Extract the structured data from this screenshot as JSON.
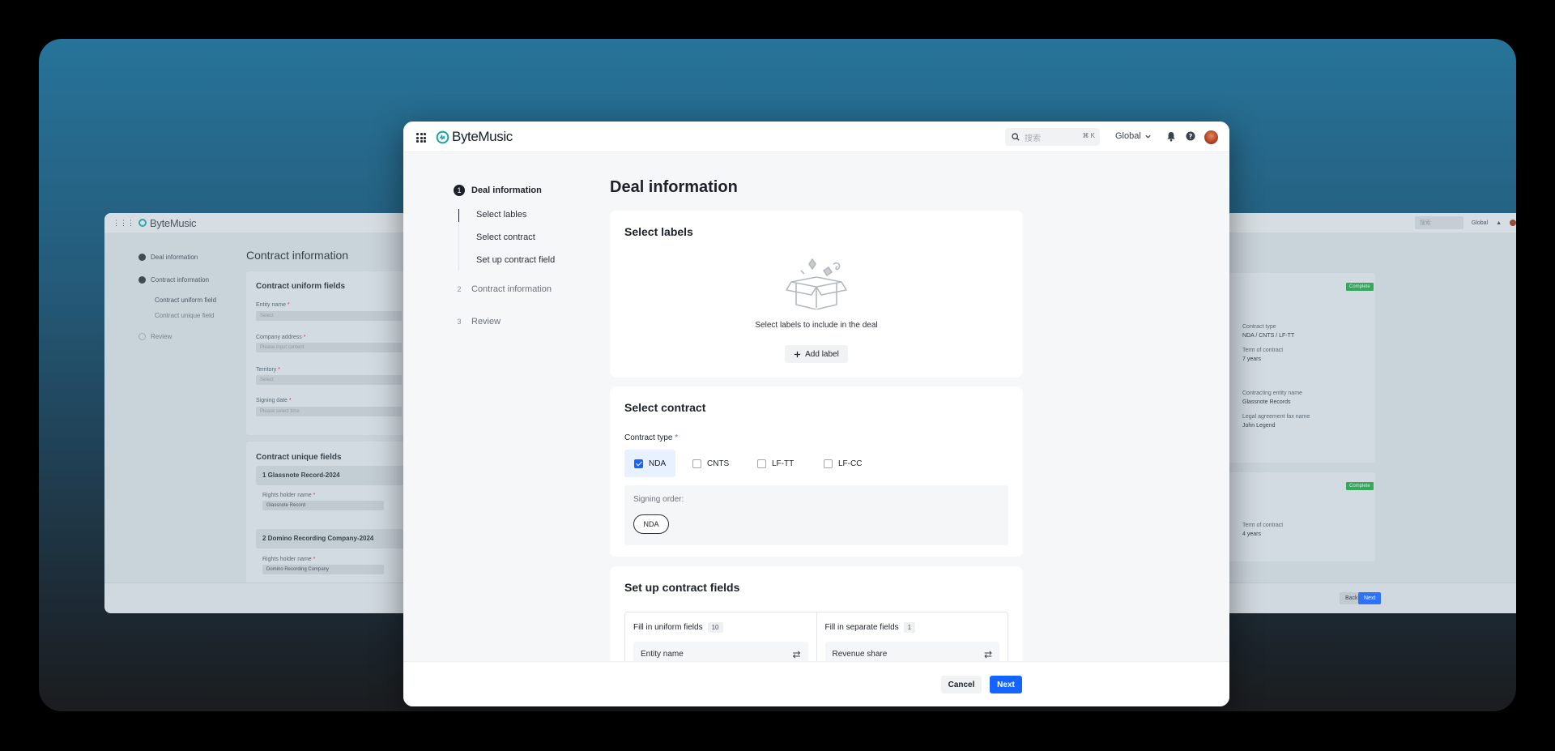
{
  "app": {
    "name": "ByteMusic"
  },
  "search": {
    "placeholder": "搜索",
    "shortcut": "⌘ K"
  },
  "header": {
    "region": "Global"
  },
  "stepper": {
    "steps": [
      {
        "num": "1",
        "label": "Deal information"
      },
      {
        "num": "2",
        "label": "Contract information"
      },
      {
        "num": "3",
        "label": "Review"
      }
    ],
    "substeps": [
      "Select lables",
      "Select contract",
      "Set up contract field"
    ]
  },
  "page": {
    "title": "Deal information"
  },
  "labels_card": {
    "title": "Select labels",
    "empty_text": "Select labels to include in the deal",
    "add_button": "Add label"
  },
  "contract_card": {
    "title": "Select contract",
    "field_label": "Contract type",
    "required_mark": "*",
    "options": [
      {
        "label": "NDA",
        "checked": true
      },
      {
        "label": "CNTS",
        "checked": false
      },
      {
        "label": "LF-TT",
        "checked": false
      },
      {
        "label": "LF-CC",
        "checked": false
      }
    ],
    "signing_order_label": "Signing order:",
    "signing_order_items": [
      "NDA"
    ]
  },
  "fields_card": {
    "title": "Set up contract fields",
    "uniform": {
      "label": "Fill in uniform fields",
      "count": "10",
      "first_field": "Entity name"
    },
    "separate": {
      "label": "Fill in separate fields",
      "count": "1",
      "first_field": "Revenue share"
    }
  },
  "footer": {
    "cancel": "Cancel",
    "next": "Next"
  },
  "background_left": {
    "app_name": "ByteMusic",
    "steps": [
      "Deal information",
      "Contract information",
      "Contract uniform field",
      "Contract unique field",
      "Review"
    ],
    "title": "Contract information",
    "uniform_title": "Contract uniform fields",
    "fields": [
      {
        "label": "Entity name",
        "placeholder": "Select"
      },
      {
        "label": "Company address",
        "placeholder": "Please input content"
      },
      {
        "label": "Territory",
        "placeholder": "Select"
      },
      {
        "label": "Signing date",
        "placeholder": "Please select time"
      }
    ],
    "unique_title": "Contract unique fields",
    "rows": [
      {
        "title": "1  Glassnote Record-2024",
        "sub_label": "Rights holder name",
        "sub_value": "Glassnote Record"
      },
      {
        "title": "2  Domino Recording Company-2024",
        "sub_label": "Rights holder name",
        "sub_value": "Domino Recording Company"
      }
    ]
  },
  "background_right": {
    "search_placeholder": "搜索",
    "region": "Global",
    "tag": "Complete",
    "items": [
      {
        "label": "Contract type",
        "value": "NDA / CNTS / LF-TT"
      },
      {
        "label": "Term of contract",
        "value": "7 years"
      },
      {
        "label": "Contracting entity name",
        "value": "Glassnote Records"
      },
      {
        "label": "Legal agreement fax name",
        "value": "John Legend"
      },
      {
        "label": "Term of contract",
        "value": "4 years"
      }
    ],
    "back": "Back",
    "next": "Next"
  },
  "colors": {
    "primary": "#1664ff",
    "required": "#f53f3f",
    "complete": "#22a34a"
  },
  "icons": [
    "apps-grid-icon",
    "search-icon",
    "chevron-down-icon",
    "bell-icon",
    "help-icon",
    "plus-icon",
    "swap-icon",
    "empty-box-icon"
  ]
}
